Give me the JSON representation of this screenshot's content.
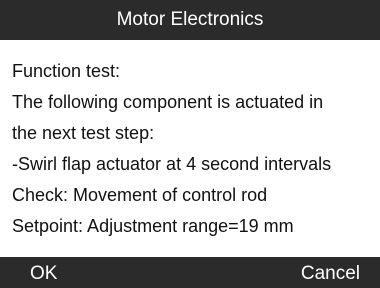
{
  "title": "Motor Electronics",
  "message_lines": [
    "Function test:",
    "The following component is actuated in",
    "the next test step:",
    "-Swirl flap actuator at 4 second intervals",
    "Check: Movement of control rod",
    "Setpoint: Adjustment range=19 mm"
  ],
  "buttons": {
    "ok_label": "OK",
    "cancel_label": "Cancel"
  },
  "colors": {
    "bar_background": "#2b2b2b",
    "bar_text": "#ffffff",
    "body_background": "#ffffff",
    "body_text": "#111111"
  }
}
